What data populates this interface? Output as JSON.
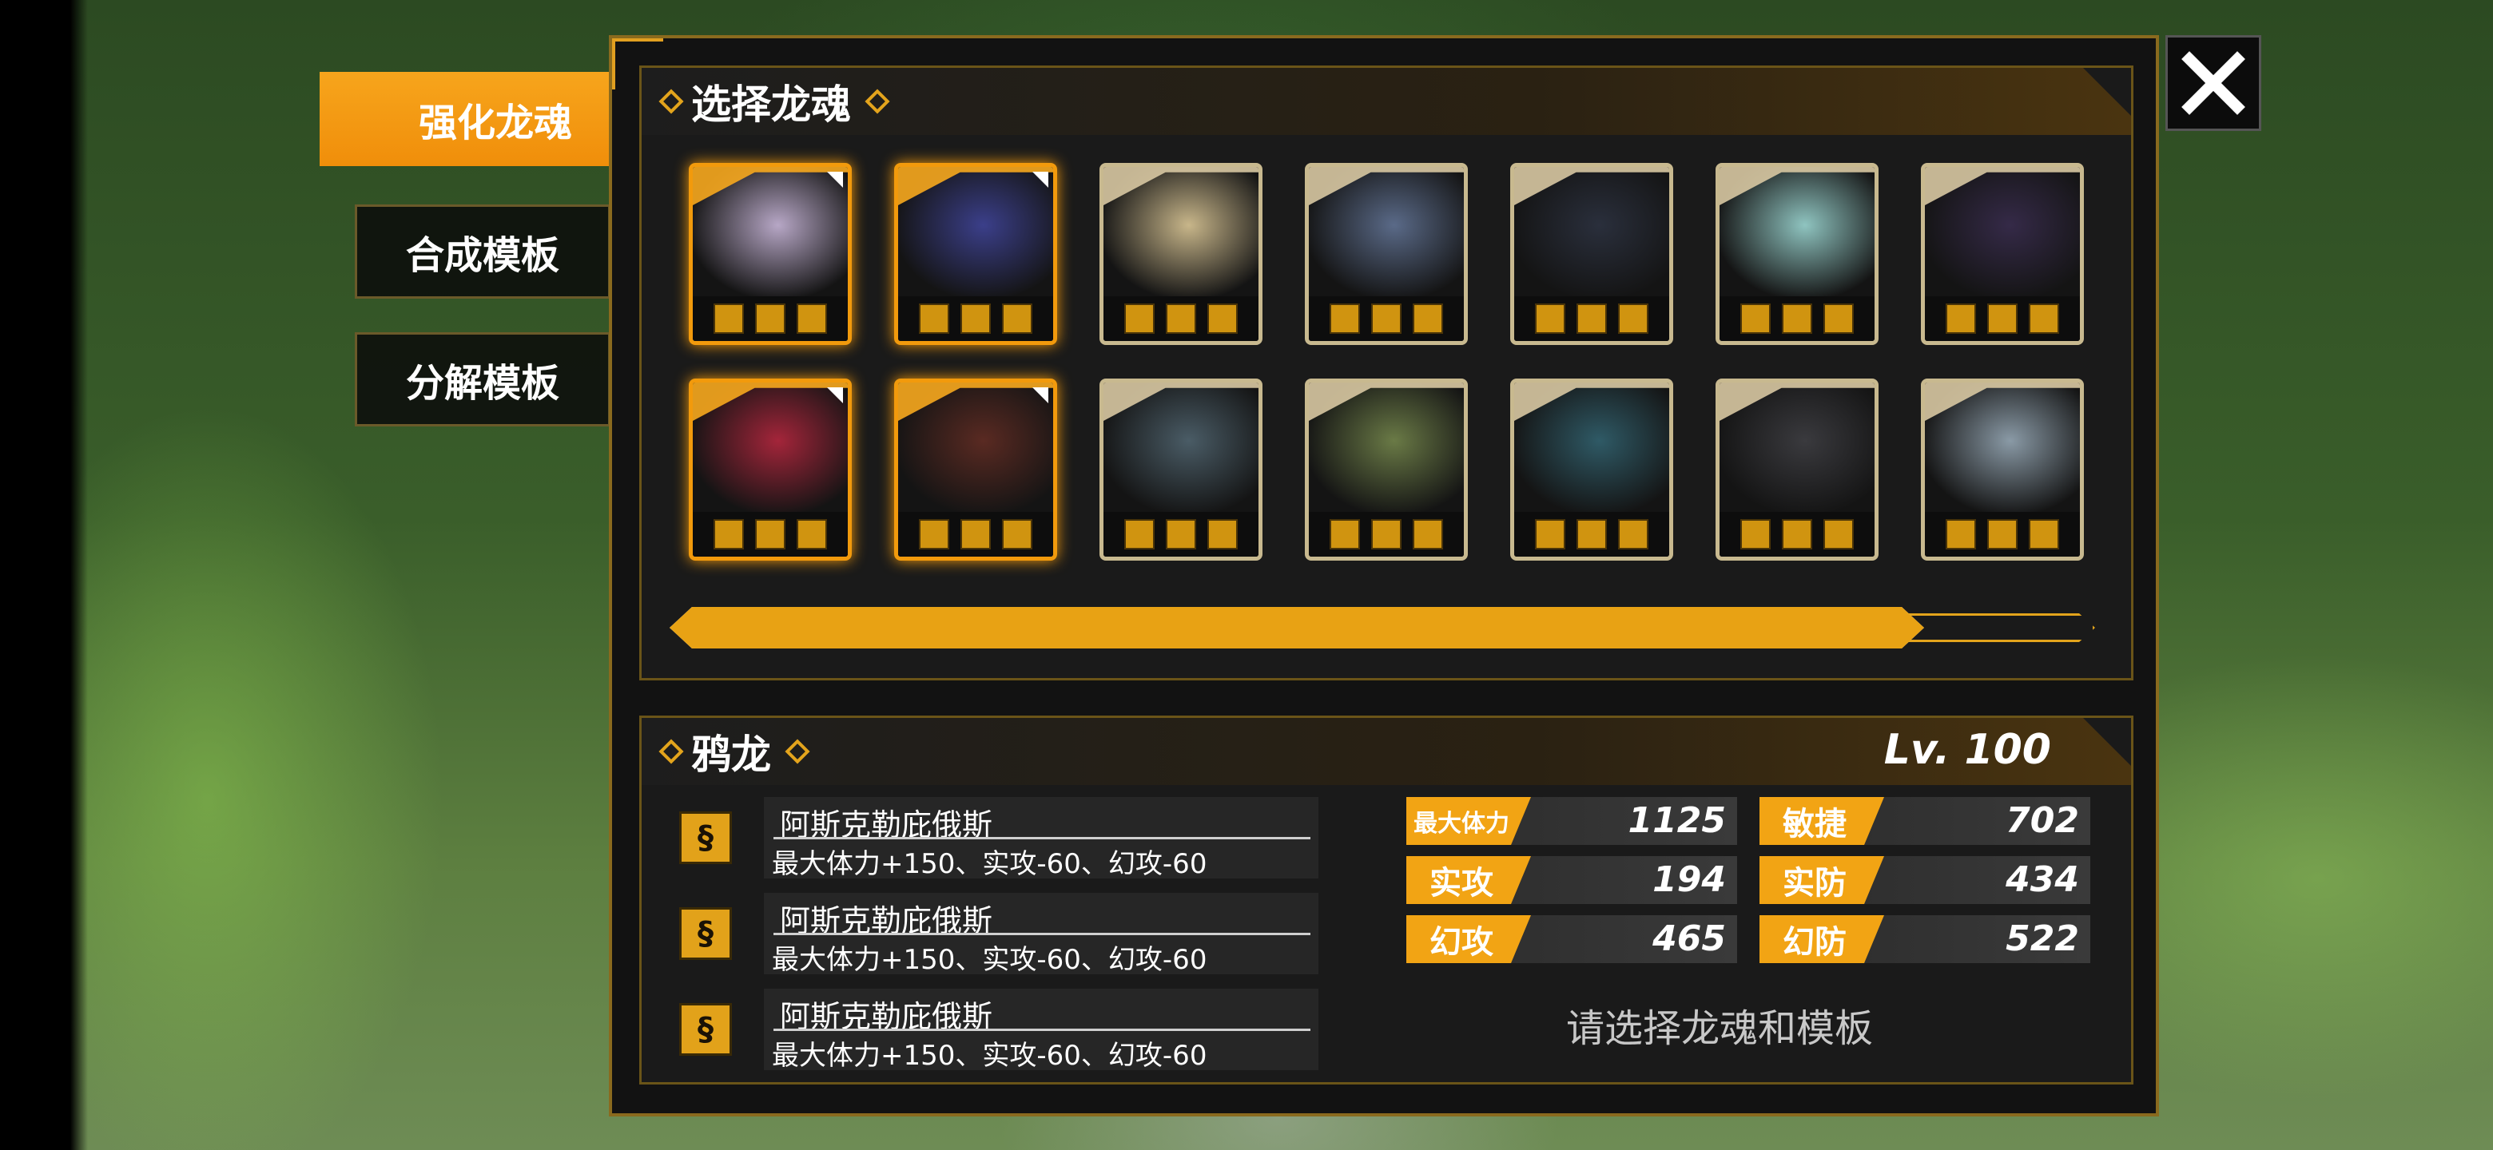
{
  "nav": {
    "items": [
      {
        "label": "强化龙魂",
        "active": true
      },
      {
        "label": "合成模板",
        "active": false
      },
      {
        "label": "分解模板",
        "active": false
      }
    ]
  },
  "select_panel": {
    "title": "选择龙魂",
    "cards": [
      {
        "name": "dragon-soul-1",
        "selected": true,
        "art_color": "#b7a7c6",
        "icon_name": "beast-icon"
      },
      {
        "name": "dragon-soul-2",
        "selected": true,
        "art_color": "#3b3f8a",
        "icon_name": "serpent-icon"
      },
      {
        "name": "dragon-soul-3",
        "selected": false,
        "art_color": "#c8b68a",
        "icon_name": "beast-icon"
      },
      {
        "name": "dragon-soul-4",
        "selected": false,
        "art_color": "#5a6a88",
        "icon_name": "serpent-icon"
      },
      {
        "name": "dragon-soul-5",
        "selected": false,
        "art_color": "#2a2f3c",
        "icon_name": "grid-icon"
      },
      {
        "name": "dragon-soul-6",
        "selected": false,
        "art_color": "#8fc4c0",
        "icon_name": "target-icon"
      },
      {
        "name": "dragon-soul-7",
        "selected": false,
        "art_color": "#352a48",
        "icon_name": "moon-icon"
      },
      {
        "name": "dragon-soul-8",
        "selected": true,
        "art_color": "#a4253a",
        "icon_name": "helmet-icon"
      },
      {
        "name": "dragon-soul-9",
        "selected": true,
        "art_color": "#5a2a22",
        "icon_name": "claw-icon"
      },
      {
        "name": "dragon-soul-10",
        "selected": false,
        "art_color": "#4a5c66",
        "icon_name": "fork-icon"
      },
      {
        "name": "dragon-soul-11",
        "selected": false,
        "art_color": "#6a7a46",
        "icon_name": "lightning-icon"
      },
      {
        "name": "dragon-soul-12",
        "selected": false,
        "art_color": "#2f5a66",
        "icon_name": "mask-icon"
      },
      {
        "name": "dragon-soul-13",
        "selected": false,
        "art_color": "#3a3a3e",
        "icon_name": "wing-icon"
      },
      {
        "name": "dragon-soul-14",
        "selected": false,
        "art_color": "#8a9aa6",
        "icon_name": "fork-icon"
      }
    ],
    "scroll_fraction": 0.88
  },
  "detail": {
    "name": "鸦龙",
    "level": "Lv. 100",
    "skills": [
      {
        "name": "阿斯克勒庇俄斯",
        "desc": "最大体力+150、实攻-60、幻攻-60"
      },
      {
        "name": "阿斯克勒庇俄斯",
        "desc": "最大体力+150、实攻-60、幻攻-60"
      },
      {
        "name": "阿斯克勒庇俄斯",
        "desc": "最大体力+150、实攻-60、幻攻-60"
      }
    ],
    "stats": [
      {
        "label": "最大体力",
        "value": "1125"
      },
      {
        "label": "敏捷",
        "value": "702"
      },
      {
        "label": "实攻",
        "value": "194"
      },
      {
        "label": "实防",
        "value": "434"
      },
      {
        "label": "幻攻",
        "value": "465"
      },
      {
        "label": "幻防",
        "value": "522"
      }
    ],
    "hint": "请选择龙魂和模板"
  },
  "colors": {
    "accent": "#f2a414",
    "panel": "#121212",
    "border": "#8a6a1e"
  }
}
